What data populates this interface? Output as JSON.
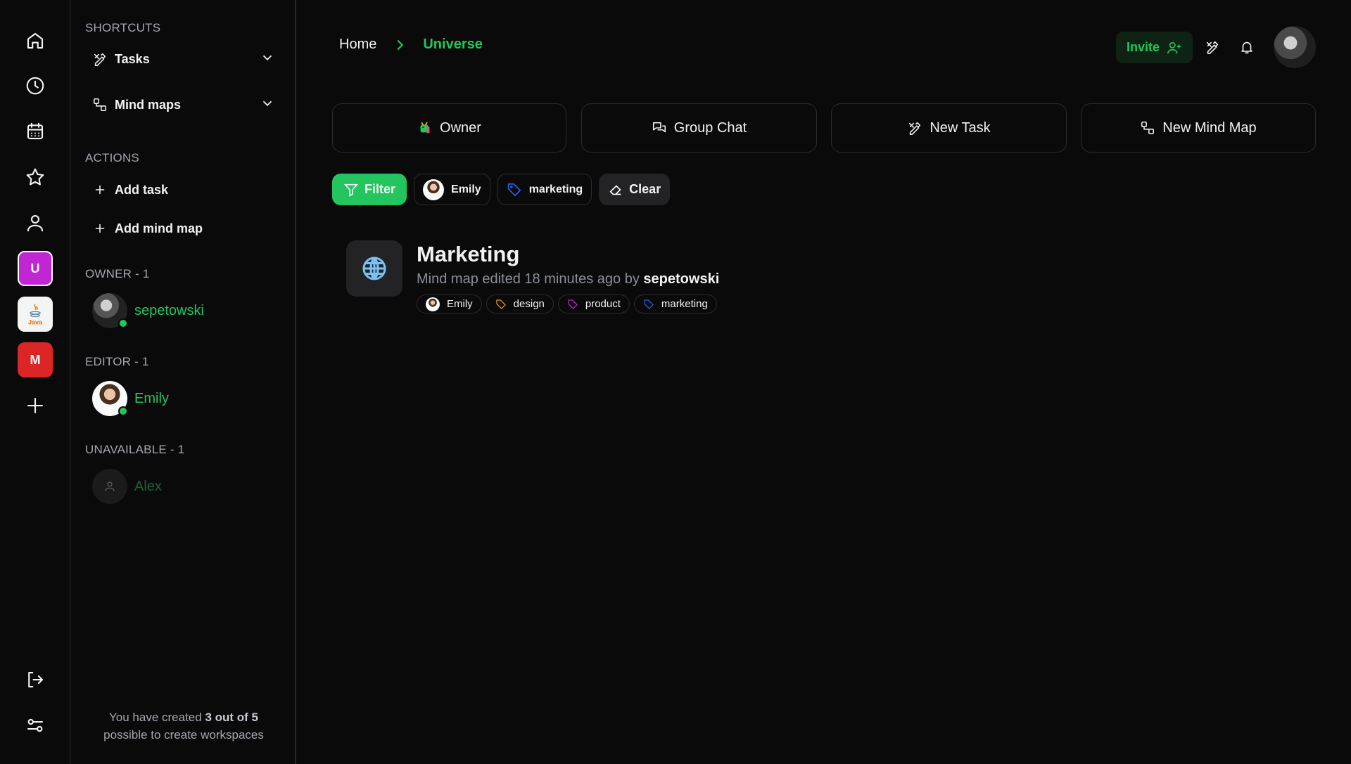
{
  "rail": {
    "nav_icons": [
      "home-icon",
      "clock-icon",
      "calendar-icon",
      "star-icon",
      "user-icon"
    ],
    "workspaces": [
      {
        "label": "U",
        "color": "#c026d3",
        "active": true
      },
      {
        "label": "Java",
        "color": "#f4f4f4",
        "active": false
      },
      {
        "label": "M",
        "color": "#dc2626",
        "active": false
      }
    ],
    "add_icon": "plus-icon",
    "bottom_icons": [
      "logout-icon",
      "settings-sliders-icon"
    ]
  },
  "sidebar": {
    "shortcuts_label": "SHORTCUTS",
    "shortcuts": [
      {
        "label": "Tasks",
        "icon": "task-icon"
      },
      {
        "label": "Mind maps",
        "icon": "mindmap-icon"
      }
    ],
    "actions_label": "ACTIONS",
    "actions": [
      {
        "label": "Add task"
      },
      {
        "label": "Add mind map"
      }
    ],
    "groups": [
      {
        "label": "OWNER - 1",
        "members": [
          {
            "name": "sepetowski",
            "online": true
          }
        ]
      },
      {
        "label": "EDITOR - 1",
        "members": [
          {
            "name": "Emily",
            "online": true
          }
        ]
      },
      {
        "label": "UNAVAILABLE - 1",
        "members": [
          {
            "name": "Alex",
            "online": false
          }
        ]
      }
    ],
    "quota": {
      "prefix": "You have created ",
      "bold": "3 out of 5",
      "suffix": "possible to create workspaces"
    }
  },
  "header": {
    "breadcrumb": {
      "home": "Home",
      "current": "Universe"
    },
    "invite_label": "Invite",
    "accent": "#22c55e"
  },
  "quick_actions": [
    {
      "label": "Owner",
      "icon": "dragon-emoji-icon"
    },
    {
      "label": "Group Chat",
      "icon": "chat-icon"
    },
    {
      "label": "New Task",
      "icon": "task-icon"
    },
    {
      "label": "New Mind Map",
      "icon": "mindmap-icon"
    }
  ],
  "filter_bar": {
    "filter_label": "Filter",
    "active_user": "Emily",
    "active_tag": "marketing",
    "clear_label": "Clear"
  },
  "results": [
    {
      "title": "Marketing",
      "meta_prefix": "Mind map edited 18 minutes ago by ",
      "meta_user": "sepetowski",
      "icon": "globe-icon",
      "assignee": "Emily",
      "tags": [
        {
          "label": "design",
          "color": "#f59e0b"
        },
        {
          "label": "product",
          "color": "#c026d3"
        },
        {
          "label": "marketing",
          "color": "#2563eb"
        }
      ]
    }
  ]
}
